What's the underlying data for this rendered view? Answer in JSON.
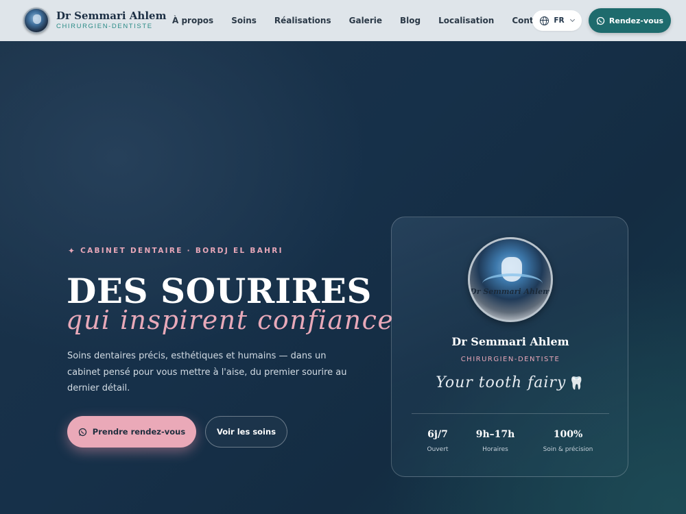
{
  "header": {
    "brand_name": "Dr Semmari Ahlem",
    "brand_subtitle": "CHIRURGIEN-DENTISTE",
    "nav": [
      "À propos",
      "Soins",
      "Réalisations",
      "Galerie",
      "Blog",
      "Localisation",
      "Contact"
    ],
    "language": "FR",
    "cta_label": "Rendez-vous"
  },
  "hero": {
    "eyebrow": "CABINET DENTAIRE · BORDJ EL BAHRI",
    "title": "DES SOURIRES",
    "subtitle": "qui inspirent confiance",
    "description": "Soins dentaires précis, esthétiques et humains — dans un cabinet pensé pour vous mettre à l'aise, du premier sourire au dernier détail.",
    "primary_cta": "Prendre rendez-vous",
    "secondary_cta": "Voir les soins"
  },
  "card": {
    "logo_text": "Dr Semmari Ahlem",
    "name": "Dr Semmari Ahlem",
    "role": "CHIRURGIEN-DENTISTE",
    "tagline": "Your tooth fairy",
    "tagline_emoji": "🦷",
    "stats": [
      {
        "value": "6j/7",
        "label": "Ouvert"
      },
      {
        "value": "9h–17h",
        "label": "Horaires"
      },
      {
        "value": "100%",
        "label": "Soin & précision"
      }
    ]
  },
  "colors": {
    "accent_pink": "#e7a7b8",
    "accent_teal": "#1e6b6d",
    "background": "#163049"
  }
}
